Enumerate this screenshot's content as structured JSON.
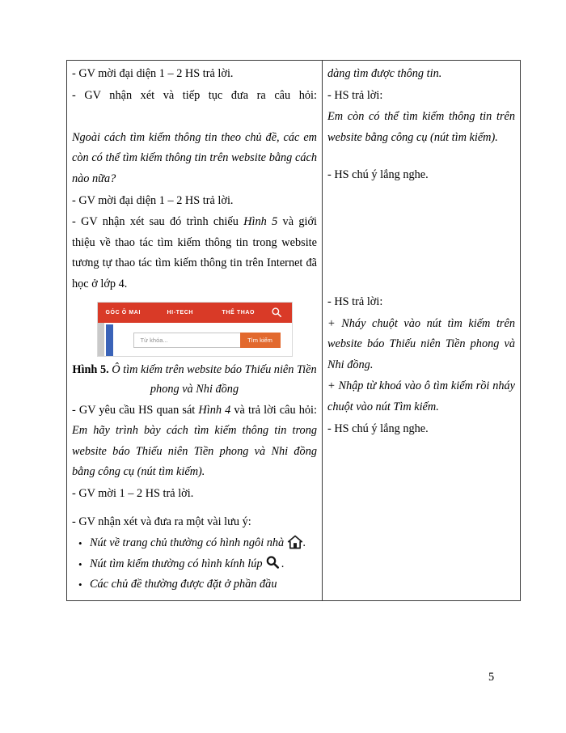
{
  "page": {
    "number": "5"
  },
  "left_column": {
    "paragraphs": [
      {
        "id": "p1",
        "text": "- GV mời đại diện 1 – 2 HS trả lời.",
        "style": "normal"
      },
      {
        "id": "p2",
        "text": "- GV nhận xét và tiếp tục đưa ra câu hỏi:",
        "style": "normal"
      },
      {
        "id": "p3",
        "text": "Ngoài cách tìm kiếm thông tin theo chủ đề, các em còn có thể tìm kiếm thông tin trên website bằng cách nào nữa?",
        "style": "italic"
      },
      {
        "id": "p4",
        "text": "- GV mời đại diện 1 – 2 HS trả lời.",
        "style": "normal"
      },
      {
        "id": "p5",
        "text": "- GV nhận xét sau đó trình chiếu ",
        "style": "normal"
      },
      {
        "id": "p5b",
        "text": "Hình 5",
        "style": "italic"
      },
      {
        "id": "p5c",
        "text": " và giới thiệu về thao tác tìm kiếm thông tin trong website tương tự thao tác tìm kiếm thông tin trên Internet đã học ở lớp 4.",
        "style": "normal"
      }
    ],
    "after_figure": {
      "lead_normal": "- GV yêu cầu HS quan sát ",
      "lead_italic": "Hình 4",
      "lead_normal2": " và trả lời câu hỏi: ",
      "question_italic": "Em hãy trình bày cách tìm kiếm thông tin trong website báo Thiếu niên Tiền phong và Nhi đồng bằng công cụ (nút tìm kiếm).",
      "invite": "- GV mời 1 – 2 HS trả lời.",
      "notes_intro": "- GV nhận xét và đưa ra một vài lưu ý:"
    },
    "bullets": [
      {
        "text_before": "Nút về trang chủ thường có hình ngôi nhà ",
        "icon": "home-icon",
        "text_after": "."
      },
      {
        "text_before": "Nút tìm kiếm thường có hình kính lúp ",
        "icon": "search-icon",
        "text_after": "."
      },
      {
        "text_before": "Các chủ đề thường được đặt ở phần đầu",
        "icon": "",
        "text_after": ""
      }
    ]
  },
  "figure": {
    "caption_label": "Hình 5.",
    "caption_text": "Ô tìm kiếm trên website báo Thiếu niên Tiền phong và Nhi đồng",
    "website": {
      "nav_items": [
        "GÓC Ô MAI",
        "HI-TECH",
        "THỂ THAO"
      ],
      "nav_search_icon": "search-icon",
      "search_placeholder": "Từ khóa...",
      "search_button_label": "Tìm kiếm",
      "colors": {
        "nav_background": "#d93a27",
        "caret": "#e8763c",
        "search_button": "#e2692e",
        "blue_bar": "#3a63b8"
      }
    }
  },
  "right_column": {
    "paragraphs": [
      {
        "id": "r1",
        "text": "dàng tìm được thông tin.",
        "style": "italic"
      },
      {
        "id": "r2",
        "text": "- HS trả lời:",
        "style": "normal"
      },
      {
        "id": "r3",
        "text": "Em còn có thể tìm kiếm thông tin trên website bằng công cụ (nút tìm kiếm).",
        "style": "italic"
      },
      {
        "id": "r4",
        "text": "- HS chú ý lắng nghe.",
        "style": "normal"
      },
      {
        "id": "r5",
        "text": "- HS trả lời:",
        "style": "normal"
      },
      {
        "id": "r6",
        "text": "+ Nháy chuột vào nút tìm kiếm trên website báo Thiếu niên Tiền phong và Nhi đồng.",
        "style": "italic"
      },
      {
        "id": "r7",
        "text": "+ Nhập từ khoá vào ô tìm kiếm rồi nháy chuột vào nút Tìm kiếm.",
        "style": "italic"
      },
      {
        "id": "r8",
        "text": "- HS chú ý lắng nghe.",
        "style": "normal"
      }
    ]
  }
}
